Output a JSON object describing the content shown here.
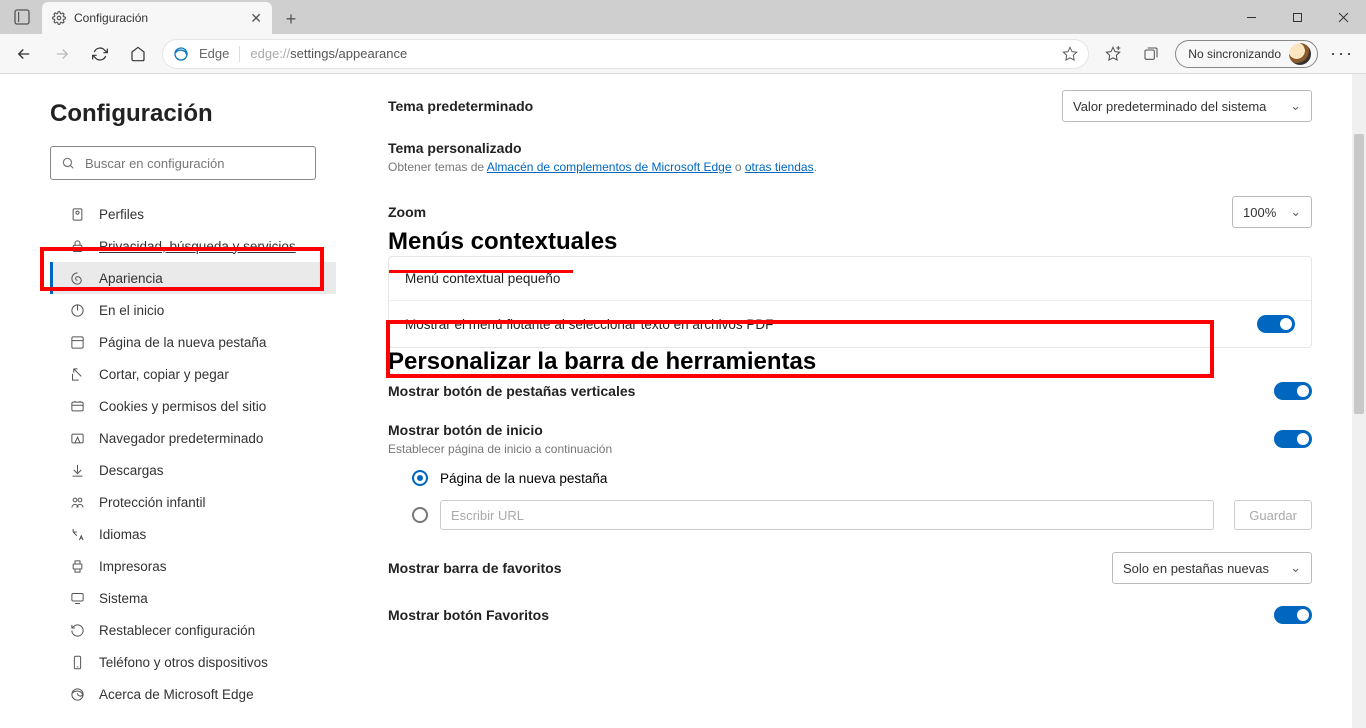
{
  "tab": {
    "title": "Configuración"
  },
  "address": {
    "app": "Edge",
    "url_prefix": "edge://",
    "url_path": "settings/appearance"
  },
  "sync": {
    "label": "No sincronizando"
  },
  "sidebar": {
    "title": "Configuración",
    "search_placeholder": "Buscar en configuración",
    "items": [
      {
        "label": "Perfiles"
      },
      {
        "label": "Privacidad, búsqueda y servicios"
      },
      {
        "label": "Apariencia"
      },
      {
        "label": "En el inicio"
      },
      {
        "label": "Página de la nueva pestaña"
      },
      {
        "label": "Cortar, copiar y pegar"
      },
      {
        "label": "Cookies y permisos del sitio"
      },
      {
        "label": "Navegador predeterminado"
      },
      {
        "label": "Descargas"
      },
      {
        "label": "Protección infantil"
      },
      {
        "label": "Idiomas"
      },
      {
        "label": "Impresoras"
      },
      {
        "label": "Sistema"
      },
      {
        "label": "Restablecer configuración"
      },
      {
        "label": "Teléfono y otros dispositivos"
      },
      {
        "label": "Acerca de Microsoft Edge"
      }
    ]
  },
  "content": {
    "default_theme_label": "Tema predeterminado",
    "default_theme_value": "Valor predeterminado del sistema",
    "custom_theme_label": "Tema personalizado",
    "custom_theme_prefix": "Obtener temas de ",
    "custom_theme_link1": "Almacén de complementos de Microsoft Edge",
    "custom_theme_mid": " o ",
    "custom_theme_link2": "otras tiendas",
    "custom_theme_suffix": ".",
    "zoom_label": "Zoom",
    "zoom_value": "100%",
    "context_heading": "Menús contextuales",
    "context_row1": "Menú contextual pequeño",
    "context_row2": "Mostrar el menú flotante al seleccionar texto en archivos PDF",
    "toolbar_heading": "Personalizar la barra de herramientas",
    "vertical_tabs": "Mostrar botón de pestañas verticales",
    "home_button": "Mostrar botón de inicio",
    "home_sub": "Establecer página de inicio a continuación",
    "radio_new_tab": "Página de la nueva pestaña",
    "url_placeholder": "Escribir URL",
    "save_btn": "Guardar",
    "show_favorites_bar": "Mostrar barra de favoritos",
    "show_favorites_bar_value": "Solo en pestañas nuevas",
    "show_favorites_btn": "Mostrar botón Favoritos"
  }
}
